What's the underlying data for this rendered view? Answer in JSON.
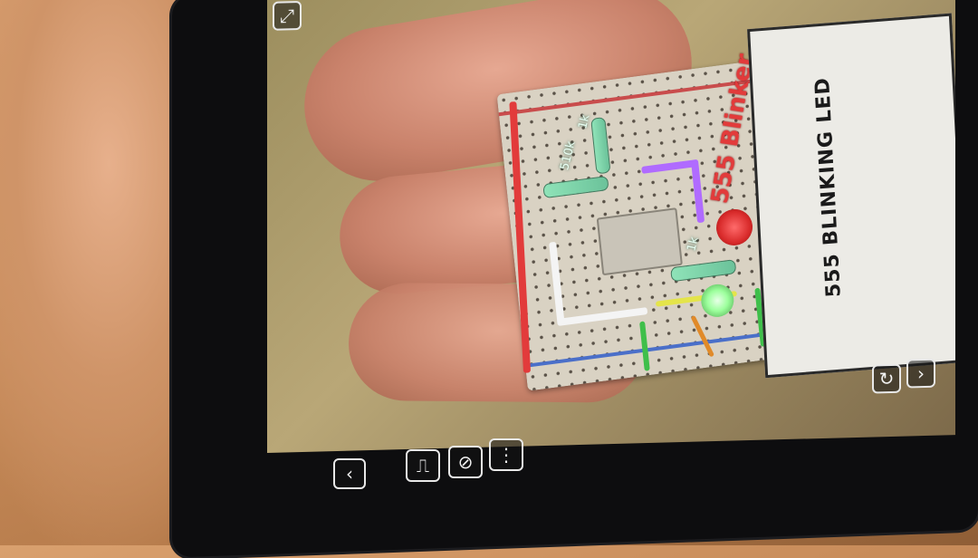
{
  "app": {
    "project_title": "555 Blinker",
    "card_title": "555 BLINKING LED"
  },
  "components": {
    "resistor_labels": [
      "510k",
      "1k",
      "1k"
    ]
  },
  "toolbar": {
    "icons": [
      "chevron-left-icon",
      "waveform-icon",
      "component-icon",
      "info-list-icon"
    ],
    "right_icons": [
      "refresh-icon",
      "chevron-right-icon"
    ]
  },
  "overlay": {
    "top_left_icon": "expand-icon"
  },
  "colors": {
    "wire_red": "#e23b3b",
    "wire_purple": "#b06bff",
    "wire_green": "#3fbf4a",
    "wire_yellow": "#e4e44a",
    "led_green": "#9cff9c",
    "led_red": "#d82a2a"
  }
}
